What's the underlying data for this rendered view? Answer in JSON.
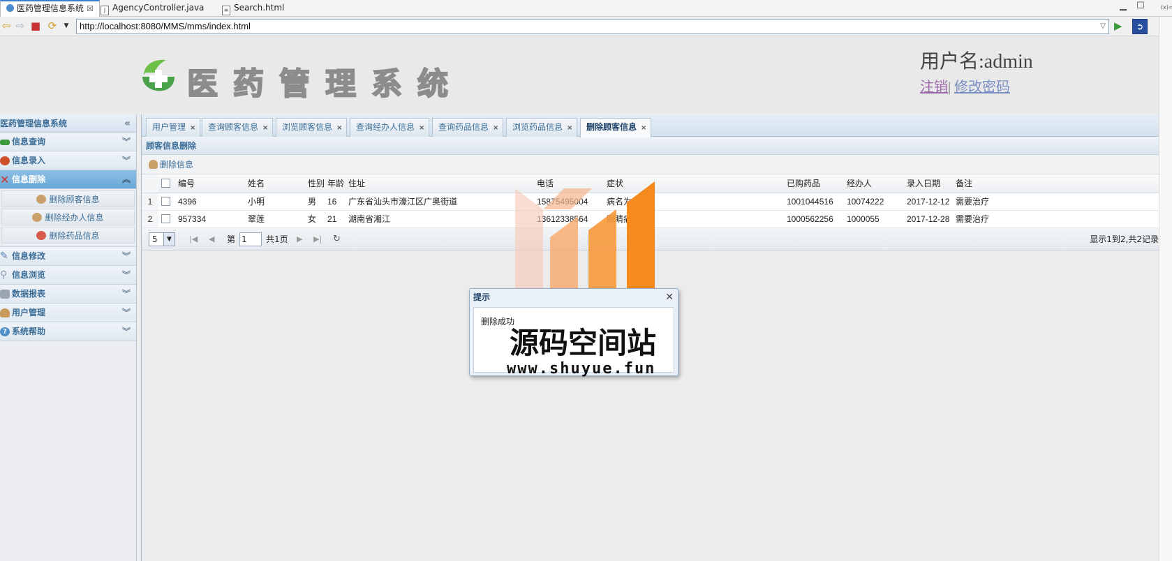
{
  "ide": {
    "tabs": [
      {
        "label": "医药管理信息系统",
        "close": "☒"
      },
      {
        "label": "AgencyController.java"
      },
      {
        "label": "Search.html"
      }
    ],
    "gutter_label": "(x)="
  },
  "browser": {
    "url": "http://localhost:8080/MMS/mms/index.html"
  },
  "header": {
    "logo_text": "医药管理系统",
    "username": "用户名:admin",
    "logout": "注销",
    "separator": "|",
    "change_password": "修改密码"
  },
  "sidebar": {
    "title": "医药管理信息系统",
    "sections": [
      {
        "label": "信息查询",
        "color": "#3c9a3c"
      },
      {
        "label": "信息录入",
        "color": "#d0502c"
      },
      {
        "label": "信息删除",
        "color": "#d83030"
      },
      {
        "label": "信息修改",
        "color": "#5a7fb5"
      },
      {
        "label": "信息浏览",
        "color": "#8a9bb0"
      },
      {
        "label": "数据报表",
        "color": "#7f8c99"
      },
      {
        "label": "用户管理",
        "color": "#c99a5c"
      },
      {
        "label": "系统帮助",
        "color": "#4f8ec6"
      }
    ],
    "delete_items": [
      "删除顾客信息",
      "删除经办人信息",
      "删除药品信息"
    ]
  },
  "tabs": [
    {
      "label": "用户管理"
    },
    {
      "label": "查询顾客信息"
    },
    {
      "label": "浏览顾客信息"
    },
    {
      "label": "查询经办人信息"
    },
    {
      "label": "查询药品信息"
    },
    {
      "label": "浏览药品信息"
    },
    {
      "label": "删除顾客信息"
    }
  ],
  "panel": {
    "title": "顾客信息删除",
    "toolbar_button": "删除信息"
  },
  "table": {
    "columns": [
      "编号",
      "姓名",
      "性别",
      "年龄",
      "住址",
      "电话",
      "症状",
      "已购药品",
      "经办人",
      "录入日期",
      "备注"
    ],
    "rows": [
      {
        "rn": "1",
        "cells": [
          "4396",
          "小明",
          "男",
          "16",
          "广东省汕头市濠江区广奥街道",
          "15875495004",
          "病名为",
          "1001044516",
          "10074222",
          "2017-12-12",
          "需要治疗"
        ]
      },
      {
        "rn": "2",
        "cells": [
          "957334",
          "翠莲",
          "女",
          "21",
          "湖南省湘江",
          "13612338564",
          "眼睛痛",
          "1000562256",
          "1000055",
          "2017-12-28",
          "需要治疗"
        ]
      }
    ]
  },
  "pager": {
    "page_size": "5",
    "page_label": "第",
    "page_value": "1",
    "total": "共1页",
    "info": "显示1到2,共2记录"
  },
  "dialog": {
    "title": "提示",
    "message": "删除成功",
    "close": "✕"
  },
  "watermark": {
    "text": "源码空间站",
    "url": "www.shuyue.fun"
  },
  "colors": {
    "accent": "#3c6e98",
    "active_section": "#6aa8d8",
    "watermark_orange": "#f58a1f"
  }
}
